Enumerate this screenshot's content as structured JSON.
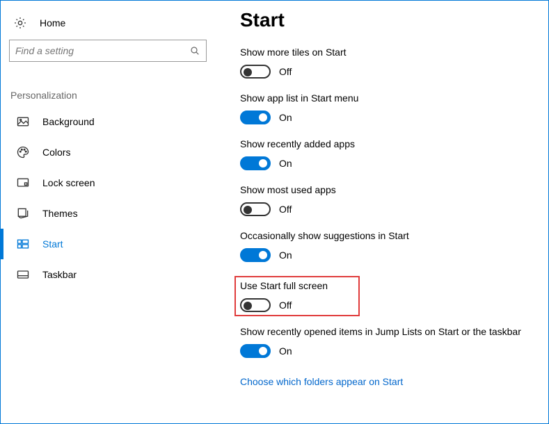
{
  "home_label": "Home",
  "search": {
    "placeholder": "Find a setting"
  },
  "section_header": "Personalization",
  "nav": [
    {
      "key": "background",
      "label": "Background"
    },
    {
      "key": "colors",
      "label": "Colors"
    },
    {
      "key": "lockscreen",
      "label": "Lock screen"
    },
    {
      "key": "themes",
      "label": "Themes"
    },
    {
      "key": "start",
      "label": "Start"
    },
    {
      "key": "taskbar",
      "label": "Taskbar"
    }
  ],
  "page_title": "Start",
  "state_on": "On",
  "state_off": "Off",
  "settings": [
    {
      "key": "more-tiles",
      "label": "Show more tiles on Start",
      "on": false
    },
    {
      "key": "app-list",
      "label": "Show app list in Start menu",
      "on": true
    },
    {
      "key": "recent-apps",
      "label": "Show recently added apps",
      "on": true
    },
    {
      "key": "most-used",
      "label": "Show most used apps",
      "on": false
    },
    {
      "key": "suggestions",
      "label": "Occasionally show suggestions in Start",
      "on": true
    },
    {
      "key": "fullscreen",
      "label": "Use Start full screen",
      "on": false,
      "highlight": true
    },
    {
      "key": "jump-lists",
      "label": "Show recently opened items in Jump Lists on Start or the taskbar",
      "on": true
    }
  ],
  "link_text": "Choose which folders appear on Start",
  "colors": {
    "accent": "#0078d7",
    "highlight_border": "#e03b3b"
  }
}
